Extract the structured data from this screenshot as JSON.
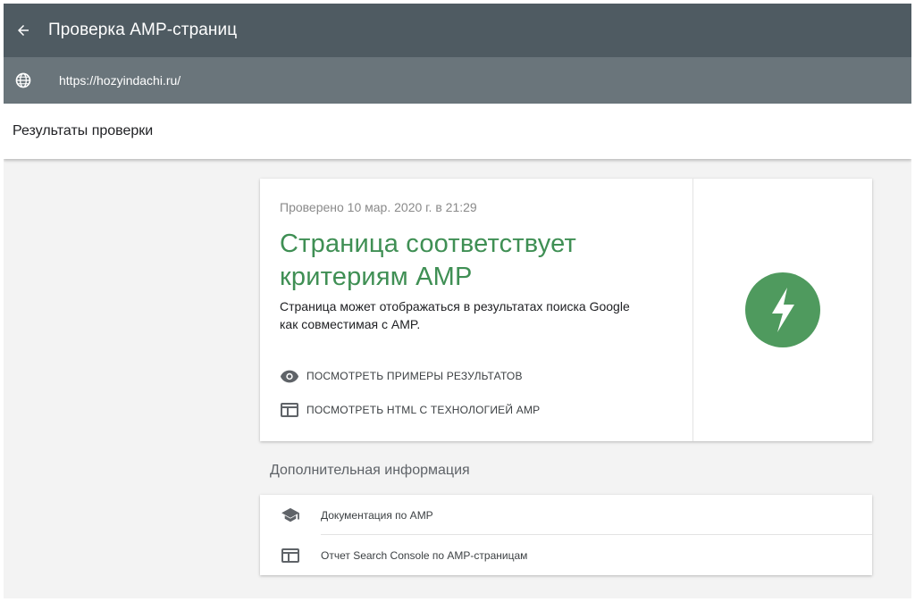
{
  "header": {
    "title": "Проверка AMP-страниц",
    "back_icon": "arrow-left-icon"
  },
  "urlbar": {
    "url": "https://hozyindachi.ru/",
    "icon": "globe-icon"
  },
  "subheader": {
    "title": "Результаты проверки"
  },
  "result": {
    "checked_date": "Проверено 10 мар. 2020 г. в 21:29",
    "status_title_line1": "Страница соответствует",
    "status_title_line2": "критериям AMP",
    "description_line1": "Страница может отображаться в результатах поиска Google",
    "description_line2": "как совместимая с AMP.",
    "actions": [
      {
        "label": "ПОСМОТРЕТЬ ПРИМЕРЫ РЕЗУЛЬТАТОВ",
        "icon": "eye-icon"
      },
      {
        "label": "ПОСМОТРЕТЬ HTML С ТЕХНОЛОГИЕЙ AMP",
        "icon": "web-page-icon"
      }
    ],
    "status_icon": "amp-lightning-icon",
    "accent_color": "#3f8f54"
  },
  "extra": {
    "title": "Дополнительная информация",
    "links": [
      {
        "label": "Документация по AMP",
        "icon": "graduation-cap-icon"
      },
      {
        "label": "Отчет Search Console по AMP-страницам",
        "icon": "web-page-icon"
      }
    ]
  },
  "colors": {
    "topbar": "#4f5b62",
    "urlbar": "#6a757b",
    "background": "#f3f3f3",
    "amp_green": "#4f9a5e"
  }
}
